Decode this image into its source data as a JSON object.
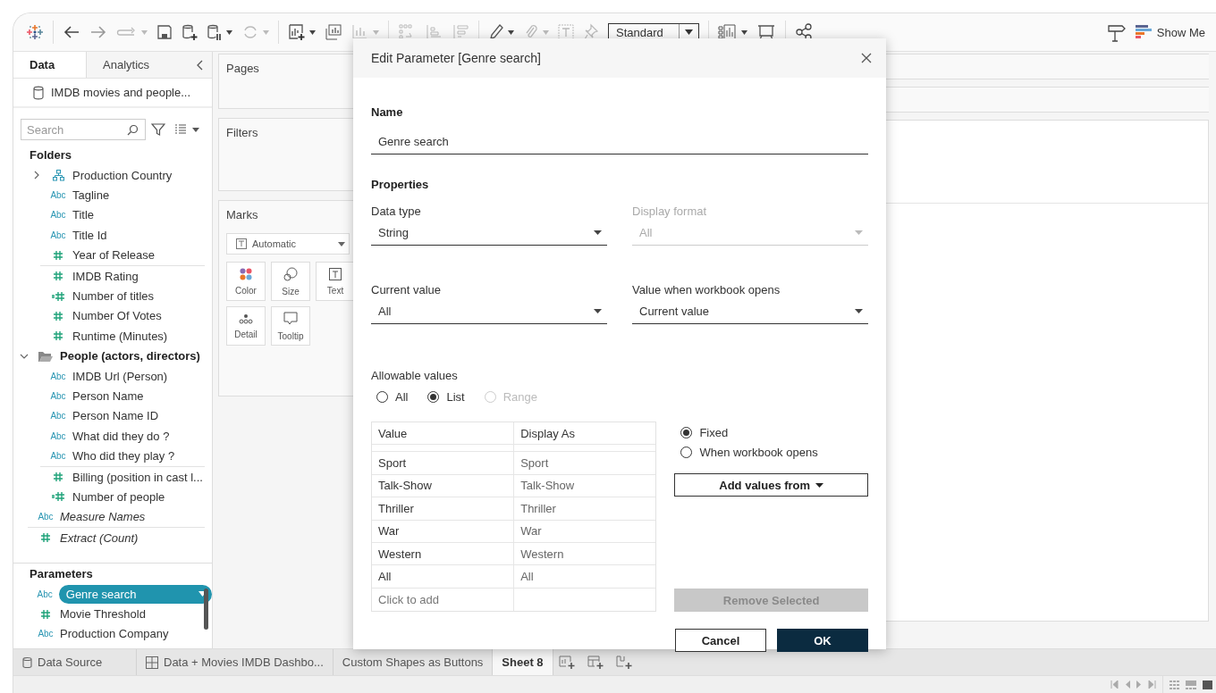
{
  "toolbar": {
    "view_size": "Standard",
    "show_me": "Show Me"
  },
  "data_pane": {
    "tabs": [
      {
        "label": "Data",
        "selected": true
      },
      {
        "label": "Analytics",
        "selected": false
      }
    ],
    "data_source": "IMDB movies and people...",
    "search": {
      "placeholder": "Search"
    },
    "folders_heading": "Folders",
    "fields": [
      {
        "kind": "hierarchy",
        "label": "Production Country",
        "expanded": false,
        "divider_above": false
      },
      {
        "kind": "string",
        "icon_text": "Abc",
        "label": "Tagline",
        "divider_above": false
      },
      {
        "kind": "string",
        "icon_text": "Abc",
        "label": "Title",
        "divider_above": false
      },
      {
        "kind": "string",
        "icon_text": "Abc",
        "label": "Title Id",
        "divider_above": false
      },
      {
        "kind": "number",
        "label": "Year of Release",
        "divider_above": false
      },
      {
        "kind": "number",
        "label": "IMDB Rating",
        "divider_above": true
      },
      {
        "kind": "calc_number",
        "label": "Number of titles",
        "divider_above": false
      },
      {
        "kind": "number",
        "label": "Number Of Votes",
        "divider_above": false
      },
      {
        "kind": "number",
        "label": "Runtime (Minutes)",
        "divider_above": false
      }
    ],
    "folders": [
      {
        "label": "People (actors, directors)",
        "expanded": true,
        "fields": [
          {
            "kind": "string",
            "icon_text": "Abc",
            "label": "IMDB Url (Person)",
            "divider_above": false
          },
          {
            "kind": "string",
            "icon_text": "Abc",
            "label": "Person Name",
            "divider_above": false
          },
          {
            "kind": "string",
            "icon_text": "Abc",
            "label": "Person Name ID",
            "divider_above": false
          },
          {
            "kind": "string",
            "icon_text": "Abc",
            "label": "What did they do ?",
            "divider_above": false
          },
          {
            "kind": "string",
            "icon_text": "Abc",
            "label": "Who did they play ?",
            "divider_above": false
          },
          {
            "kind": "number",
            "label": "Billing (position in cast l...",
            "divider_above": true
          },
          {
            "kind": "calc_number",
            "label": "Number of people",
            "divider_above": false
          }
        ]
      }
    ],
    "other_fields": [
      {
        "kind": "string",
        "icon_text": "Abc",
        "label": "Measure Names",
        "generated": true,
        "divider_above": false
      },
      {
        "kind": "number",
        "label": "Extract (Count)",
        "generated": true,
        "divider_above": true
      }
    ],
    "parameters_heading": "Parameters",
    "parameters": [
      {
        "kind": "string",
        "icon_text": "Abc",
        "label": "Genre search",
        "selected": true
      },
      {
        "kind": "number",
        "label": "Movie Threshold",
        "selected": false
      },
      {
        "kind": "string",
        "icon_text": "Abc",
        "label": "Production Company",
        "selected": false
      }
    ]
  },
  "shelves": {
    "pages": "Pages",
    "filters": "Filters",
    "marks": {
      "title": "Marks",
      "mark_type": "Automatic",
      "cards": [
        {
          "kind": "color",
          "label": "Color"
        },
        {
          "kind": "size",
          "label": "Size"
        },
        {
          "kind": "text",
          "label": "Text"
        },
        {
          "kind": "detail",
          "label": "Detail"
        },
        {
          "kind": "tooltip",
          "label": "Tooltip"
        }
      ]
    }
  },
  "dialog": {
    "title": "Edit Parameter [Genre search]",
    "name_label": "Name",
    "name_value": "Genre search",
    "properties_heading": "Properties",
    "data_type": {
      "label": "Data type",
      "value": "String",
      "disabled": false
    },
    "display_format": {
      "label": "Display format",
      "value": "All",
      "disabled": true
    },
    "current_value": {
      "label": "Current value",
      "value": "All",
      "disabled": false
    },
    "open_value": {
      "label": "Value when workbook opens",
      "value": "Current value",
      "disabled": false
    },
    "allowable_label": "Allowable values",
    "allowable_options": [
      {
        "label": "All",
        "selected": false,
        "disabled": false
      },
      {
        "label": "List",
        "selected": true,
        "disabled": false
      },
      {
        "label": "Range",
        "selected": false,
        "disabled": true
      }
    ],
    "table": {
      "columns": [
        "Value",
        "Display As"
      ],
      "rows": [
        [
          "Sport",
          "Sport"
        ],
        [
          "Talk-Show",
          "Talk-Show"
        ],
        [
          "Thriller",
          "Thriller"
        ],
        [
          "War",
          "War"
        ],
        [
          "Western",
          "Western"
        ],
        [
          "All",
          "All"
        ]
      ],
      "add_placeholder": "Click to add"
    },
    "list_options": [
      {
        "label": "Fixed",
        "selected": true
      },
      {
        "label": "When workbook opens",
        "selected": false
      }
    ],
    "add_values_button": "Add values from",
    "remove_button": {
      "label": "Remove Selected",
      "disabled": true
    },
    "cancel_button": "Cancel",
    "ok_button": "OK"
  },
  "sheet_tabs": [
    {
      "kind": "data_source",
      "label": "Data Source",
      "selected": false
    },
    {
      "kind": "dashboard",
      "label": "Data + Movies IMDB Dashbo...",
      "selected": false
    },
    {
      "kind": "sheet",
      "label": "Custom Shapes as Buttons",
      "selected": false
    },
    {
      "kind": "sheet",
      "label": "Sheet 8",
      "selected": true
    }
  ]
}
